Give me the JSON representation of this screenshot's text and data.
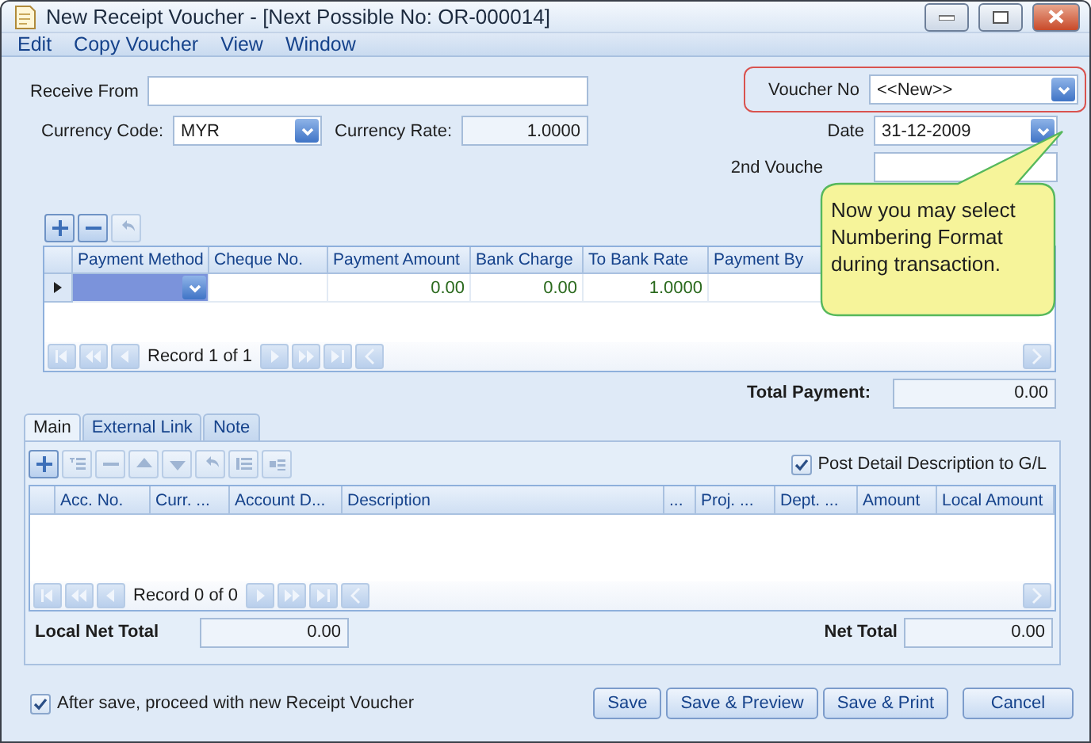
{
  "window": {
    "title": "New Receipt Voucher - [Next Possible No: OR-000014]"
  },
  "menu": [
    "Edit",
    "Copy Voucher",
    "View",
    "Window"
  ],
  "header": {
    "receive_from": {
      "label": "Receive From"
    },
    "currency_code": {
      "label": "Currency Code:",
      "value": "MYR"
    },
    "currency_rate": {
      "label": "Currency Rate:",
      "value": "1.0000"
    },
    "voucher_no": {
      "label": "Voucher No",
      "value": "<<New>>",
      "highlighted": true
    },
    "date": {
      "label": "Date",
      "value": "31-12-2009"
    },
    "second_voucher_no": {
      "label": "2nd Vouche"
    }
  },
  "callout": {
    "text": "Now you may select Numbering Format during transaction."
  },
  "payment_grid": {
    "columns": [
      "Payment Method",
      "Cheque No.",
      "Payment Amount",
      "Bank Charge",
      "To Bank Rate",
      "Payment By"
    ],
    "rows": [
      {
        "selected": true,
        "payment_amount": "0.00",
        "bank_charge": "0.00",
        "to_bank_rate": "1.0000"
      }
    ],
    "navigator": "Record 1 of 1"
  },
  "total_payment": {
    "label": "Total Payment:",
    "value": "0.00"
  },
  "tabs": [
    {
      "label": "Main",
      "selected": true
    },
    {
      "label": "External Link",
      "selected": false
    },
    {
      "label": "Note",
      "selected": false
    }
  ],
  "post_detail": {
    "label": "Post Detail Description to G/L",
    "checked": true
  },
  "detail_grid": {
    "columns": [
      "Acc. No.",
      "Curr. ...",
      "Account D...",
      "Description",
      "...",
      "Proj. ...",
      "Dept. ...",
      "Amount",
      "Local Amount"
    ],
    "navigator": "Record 0 of 0"
  },
  "local_net_total": {
    "label": "Local Net Total",
    "value": "0.00"
  },
  "net_total": {
    "label": "Net Total",
    "value": "0.00"
  },
  "proceed": {
    "label": "After save, proceed with new Receipt Voucher",
    "checked": true
  },
  "buttons": [
    "Save",
    "Save & Preview",
    "Save & Print",
    "Cancel"
  ]
}
